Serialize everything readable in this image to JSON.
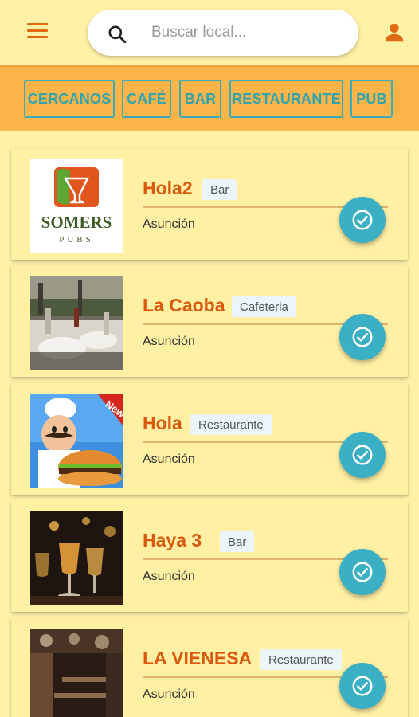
{
  "search": {
    "placeholder": "Buscar local..."
  },
  "filters": [
    "CERCANOS",
    "CAFÉ",
    "BAR",
    "RESTAURANTE",
    "PUB"
  ],
  "logo_text": {
    "line1": "SOMERS",
    "line2": "PUBS"
  },
  "burger_badge": "New",
  "places": [
    {
      "name": "Hola2",
      "category": "Bar",
      "city": "Asunción"
    },
    {
      "name": "La Caoba",
      "category": "Cafeteria",
      "city": "Asunción"
    },
    {
      "name": "Hola",
      "category": "Restaurante",
      "city": "Asunción"
    },
    {
      "name": "Haya 3",
      "category": "Bar",
      "city": "Asunción"
    },
    {
      "name": "LA VIENESA",
      "category": "Restaurante",
      "city": "Asunción"
    }
  ],
  "colors": {
    "background": "#FFF1A6",
    "filterbar": "#FDB54A",
    "accent_orange": "#D9590E",
    "chip_teal": "#2FA3AE",
    "fab_teal": "#3BAFC4"
  },
  "icons": {
    "menu": "menu-icon",
    "search": "search-icon",
    "user": "user-icon",
    "check": "check-circle-icon"
  }
}
